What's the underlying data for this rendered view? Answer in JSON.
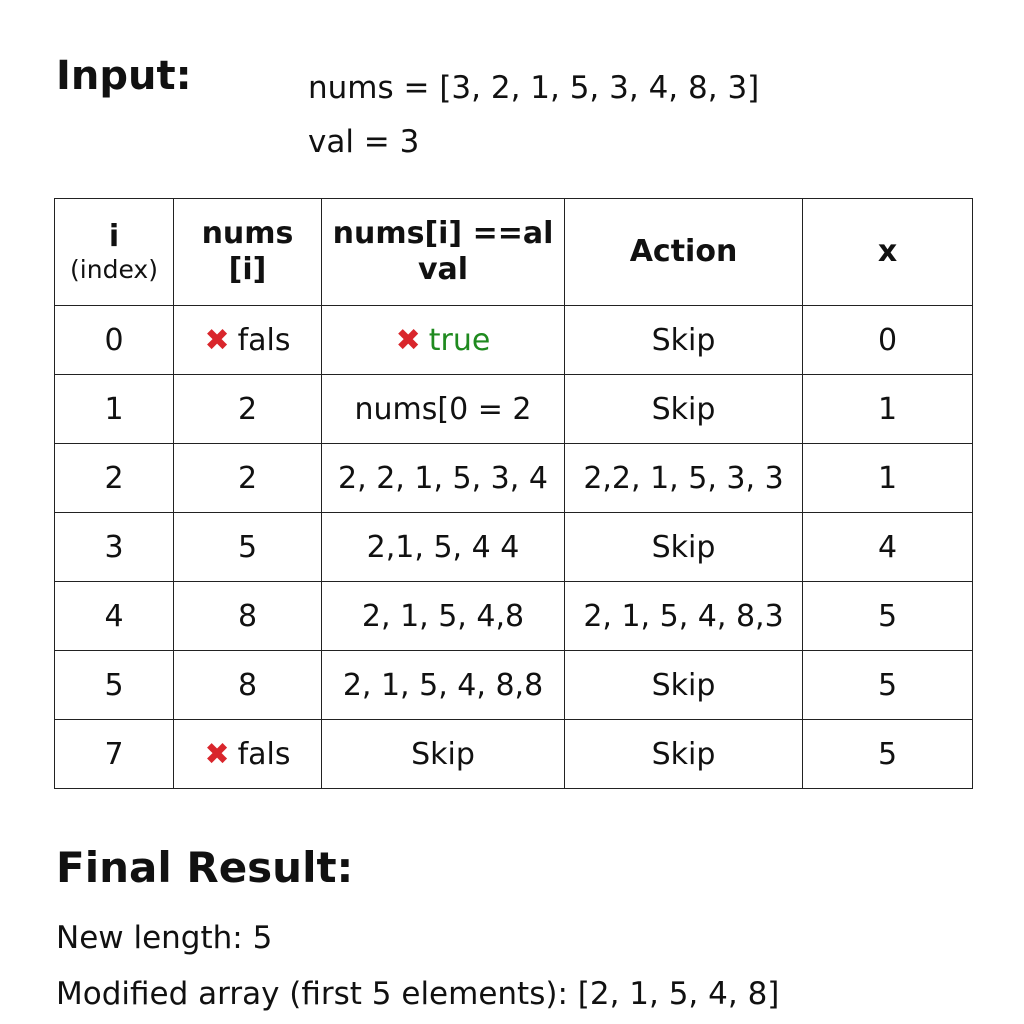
{
  "input": {
    "heading": "Input:",
    "nums_line": "nums =  [3, 2, 1, 5, 3, 4, 8, 3]",
    "val_line": "val = 3"
  },
  "table": {
    "headers": {
      "index_main": "i",
      "index_sub": "(index)",
      "nums_line1": "nums",
      "nums_line2": "[i]",
      "compare_line1": "nums[i] ==al",
      "compare_line2": "val",
      "action": "Action",
      "x": "x"
    },
    "rows": [
      {
        "i": "0",
        "nums": "fals",
        "nums_mark": "✖",
        "compare": "true",
        "compare_mark": "✖",
        "action": "Skip",
        "x": "0"
      },
      {
        "i": "1",
        "nums": "2",
        "compare": "nums[0 = 2",
        "action": "Skip",
        "x": "1"
      },
      {
        "i": "2",
        "nums": "2",
        "compare": "2, 2, 1, 5, 3, 4",
        "action": "2,2, 1, 5, 3, 3",
        "x": "1"
      },
      {
        "i": "3",
        "nums": "5",
        "compare": "2,1, 5, 4 4",
        "action": "Skip",
        "x": "4"
      },
      {
        "i": "4",
        "nums": "8",
        "compare": "2, 1, 5, 4,8",
        "action": "2, 1, 5, 4, 8,3",
        "x": "5"
      },
      {
        "i": "5",
        "nums": "8",
        "compare": "2, 1, 5, 4, 8,8",
        "action": "Skip",
        "x": "5"
      },
      {
        "i": "7",
        "nums": "fals",
        "nums_mark": "✖",
        "compare": "Skip",
        "action": "Skip",
        "x": "5"
      }
    ]
  },
  "colors": {
    "x_mark": "#d9262c",
    "true_text": "#1f8a1f",
    "grid": "#222222"
  },
  "result": {
    "heading": "Final Result:",
    "length_line": "New length: 5",
    "array_line": "Modified array (first 5 elements): [2, 1, 5, 4, 8]"
  }
}
